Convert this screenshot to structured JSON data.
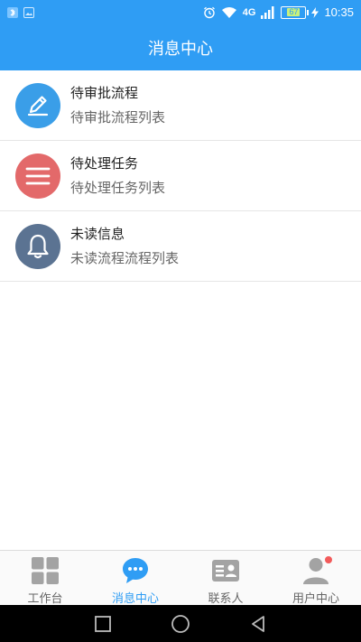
{
  "status_bar": {
    "time": "10:35",
    "battery": "67",
    "network": "4G"
  },
  "header": {
    "title": "消息中心"
  },
  "list": [
    {
      "title": "待审批流程",
      "subtitle": "待审批流程列表",
      "icon": "pencil-icon",
      "color": "#3a9ee8"
    },
    {
      "title": "待处理任务",
      "subtitle": "待处理任务列表",
      "icon": "menu-icon",
      "color": "#e3696a"
    },
    {
      "title": "未读信息",
      "subtitle": "未读流程流程列表",
      "icon": "bell-icon",
      "color": "#5b7392"
    }
  ],
  "tabbar": {
    "tabs": [
      {
        "label": "工作台",
        "icon": "grid-icon",
        "active": false
      },
      {
        "label": "消息中心",
        "icon": "chat-bubble-icon",
        "active": true
      },
      {
        "label": "联系人",
        "icon": "contact-card-icon",
        "active": false
      },
      {
        "label": "用户中心",
        "icon": "user-icon",
        "active": false,
        "badge": true
      }
    ]
  },
  "colors": {
    "primary": "#2f9df4",
    "badge": "#f25a5a"
  }
}
